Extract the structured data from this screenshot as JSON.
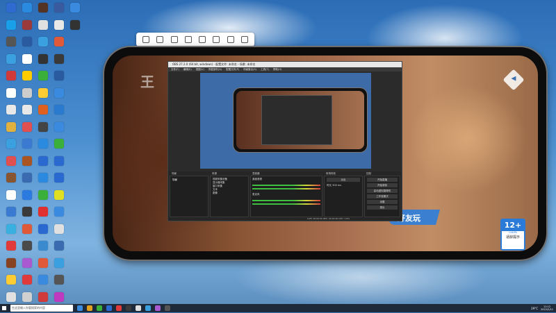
{
  "desktop": {
    "icons": [
      {
        "label": "",
        "color": "#2e6ad0"
      },
      {
        "label": "",
        "color": "#1aa0e8"
      },
      {
        "label": "",
        "color": "#555555"
      },
      {
        "label": "",
        "color": "#3aa0e0"
      },
      {
        "label": "",
        "color": "#d03a3a"
      },
      {
        "label": "",
        "color": "#ffffff"
      },
      {
        "label": "",
        "color": "#e8e8e8"
      },
      {
        "label": "",
        "color": "#e0b040"
      },
      {
        "label": "",
        "color": "#3aa0e0"
      },
      {
        "label": "",
        "color": "#e05050"
      },
      {
        "label": "",
        "color": "#885533"
      },
      {
        "label": "",
        "color": "#ffffff"
      },
      {
        "label": "",
        "color": "#3a7ad0"
      },
      {
        "label": "",
        "color": "#3ab0e0"
      },
      {
        "label": "",
        "color": "#e03a3a"
      },
      {
        "label": "",
        "color": "#884422"
      },
      {
        "label": "",
        "color": "#ffcc33"
      },
      {
        "label": "",
        "color": "#e0e0e0"
      },
      {
        "label": "",
        "color": "#2a8ae0"
      },
      {
        "label": "",
        "color": "#9a3a3a"
      },
      {
        "label": "",
        "color": "#2a5aa0"
      },
      {
        "label": "",
        "color": "#ffffff"
      },
      {
        "label": "",
        "color": "#ffcc00"
      },
      {
        "label": "",
        "color": "#cccccc"
      },
      {
        "label": "",
        "color": "#e8e8e8"
      },
      {
        "label": "",
        "color": "#e05050"
      },
      {
        "label": "",
        "color": "#3a7ad0"
      },
      {
        "label": "",
        "color": "#aa5522"
      },
      {
        "label": "",
        "color": "#3a6ab0"
      },
      {
        "label": "",
        "color": "#2a7ae0"
      },
      {
        "label": "",
        "color": "#3a3a3a"
      },
      {
        "label": "",
        "color": "#e05a3a"
      },
      {
        "label": "",
        "color": "#4a4a4a"
      },
      {
        "label": "",
        "color": "#aa5ad0"
      },
      {
        "label": "",
        "color": "#e03a3a"
      },
      {
        "label": "",
        "color": "#d0d0d0"
      },
      {
        "label": "",
        "color": "#553322"
      },
      {
        "label": "",
        "color": "#e0e0e0"
      },
      {
        "label": "",
        "color": "#3aa0e0"
      },
      {
        "label": "",
        "color": "#333333"
      },
      {
        "label": "",
        "color": "#3ab03a"
      },
      {
        "label": "",
        "color": "#ffcc33"
      },
      {
        "label": "",
        "color": "#e06020"
      },
      {
        "label": "",
        "color": "#444444"
      },
      {
        "label": "",
        "color": "#2a8ae0"
      },
      {
        "label": "",
        "color": "#2a6ad0"
      },
      {
        "label": "",
        "color": "#2a8ae0"
      },
      {
        "label": "",
        "color": "#3ab03a"
      },
      {
        "label": "",
        "color": "#e03030"
      },
      {
        "label": "",
        "color": "#2a6ad0"
      },
      {
        "label": "",
        "color": "#3a8ad0"
      },
      {
        "label": "",
        "color": "#e05a3a"
      },
      {
        "label": "",
        "color": "#3a8ae0"
      },
      {
        "label": "",
        "color": "#d03a3a"
      },
      {
        "label": "",
        "color": "#3a5aa0"
      },
      {
        "label": "",
        "color": "#e8e8e8"
      },
      {
        "label": "",
        "color": "#e05a3a"
      },
      {
        "label": "",
        "color": "#3a3a3a"
      },
      {
        "label": "",
        "color": "#2a5aa0"
      },
      {
        "label": "",
        "color": "#3a8ae0"
      },
      {
        "label": "",
        "color": "#2a7ad0"
      },
      {
        "label": "",
        "color": "#3a8ae0"
      },
      {
        "label": "",
        "color": "#3ab03a"
      },
      {
        "label": "",
        "color": "#2a6ad0"
      },
      {
        "label": "",
        "color": "#2a6ad0"
      },
      {
        "label": "",
        "color": "#e0e020"
      },
      {
        "label": "",
        "color": "#3a8ae0"
      },
      {
        "label": "",
        "color": "#e0e0e0"
      },
      {
        "label": "",
        "color": "#3a6ab0"
      },
      {
        "label": "",
        "color": "#3aa0e0"
      },
      {
        "label": "",
        "color": "#555555"
      },
      {
        "label": "",
        "color": "#c03ac0"
      },
      {
        "label": "",
        "color": "#3a8ae0"
      },
      {
        "label": "",
        "color": "#333333"
      }
    ]
  },
  "capture_toolbar": {
    "buttons": [
      "select-icon",
      "camera-icon",
      "screenshot-icon",
      "record-icon",
      "screen-icon",
      "settings-icon",
      "headset-icon",
      "cart-icon"
    ]
  },
  "phone": {
    "game_logo": "王",
    "friend_text": "好友玩",
    "age_rating": {
      "number": "12+",
      "caption": "CADPA",
      "tip": "适龄提示"
    }
  },
  "obs": {
    "title": "OBS 27.2.0 (64 bit, windows) - 配置文件: 未命名 - 场景: 未命名",
    "menu": [
      "文件(F)",
      "编辑(E)",
      "视图(V)",
      "停靠部件(D)",
      "配置文件(P)",
      "场景集合(S)",
      "工具(T)",
      "帮助(H)"
    ],
    "panels": {
      "scenes": "场景",
      "sources": "来源",
      "mixer": "混音器",
      "transitions": "转场特效",
      "controls": "控制"
    },
    "scene_item": "场景",
    "sources": [
      "视频采集设备",
      "显示器采集",
      "窗口采集",
      "文本",
      "图像"
    ],
    "mixer_tracks": [
      "桌面音频",
      "麦克风"
    ],
    "transition": {
      "type": "淡出",
      "duration_label": "时长",
      "duration": "300 ms"
    },
    "controls": [
      "开始直播",
      "开始录制",
      "启动虚拟摄像机",
      "工作室模式",
      "设置",
      "退出"
    ],
    "status": "LIVE: 00:00:00  REC: 00:00:00  CPU: 1.8%"
  },
  "taskbar": {
    "search_placeholder": "在这里输入你要搜索的内容",
    "apps": [
      {
        "color": "#3a8ae0"
      },
      {
        "color": "#e0a020"
      },
      {
        "color": "#3ab03a"
      },
      {
        "color": "#2a6ad0"
      },
      {
        "color": "#e03a3a"
      },
      {
        "color": "#3a3a3a"
      },
      {
        "color": "#e0e0e0"
      },
      {
        "color": "#3aa0e0"
      },
      {
        "color": "#aa5ad0"
      },
      {
        "color": "#555555"
      }
    ],
    "temperature": "29°C",
    "time": "11:12",
    "date": "2022/2/11"
  }
}
